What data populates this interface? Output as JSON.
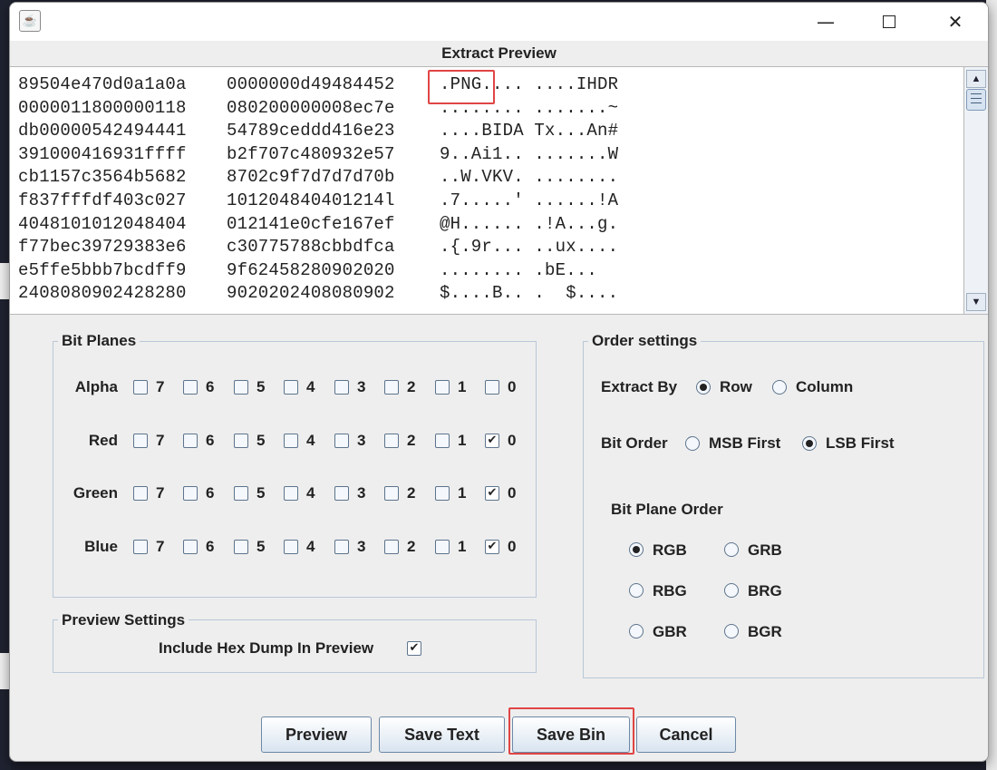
{
  "dialog": {
    "title": "Extract Preview",
    "app_icon": "java-coffee-icon"
  },
  "window_controls": {
    "minimize": "—",
    "close": "✕"
  },
  "preview": {
    "lines": [
      {
        "hex1": "89504e470d0a1a0a",
        "hex2": "0000000d49484452",
        "ascii": ".PNG.... ....IHDR"
      },
      {
        "hex1": "0000011800000118",
        "hex2": "080200000008ec7e",
        "ascii": "........ .......~"
      },
      {
        "hex1": "db00000542494441",
        "hex2": "54789ceddd416e23",
        "ascii": "....BIDA Tx...An#"
      },
      {
        "hex1": "391000416931ffff",
        "hex2": "b2f707c480932e57",
        "ascii": "9..Ai1.. .......W"
      },
      {
        "hex1": "cb1157c3564b5682",
        "hex2": "8702c9f7d7d7d70b",
        "ascii": "..W.VKV. ........"
      },
      {
        "hex1": "f837fffdf403c027",
        "hex2": "101204840401214l",
        "ascii": ".7.....' ......!A"
      },
      {
        "hex1": "4048101012048404",
        "hex2": "012141e0cfe167ef",
        "ascii": "@H...... .!A...g."
      },
      {
        "hex1": "f77bec39729383e6",
        "hex2": "c30775788cbbdfca",
        "ascii": ".{.9r... ..ux...."
      },
      {
        "hex1": "e5ffe5bbb7bcdff9",
        "hex2": "9f62458280902020",
        "ascii": "........ .bE..."
      },
      {
        "hex1": "2408080902428280",
        "hex2": "9020202408080902",
        "ascii": "$....B.. .  $...."
      }
    ]
  },
  "bit_planes": {
    "title": "Bit Planes",
    "bits": [
      "7",
      "6",
      "5",
      "4",
      "3",
      "2",
      "1",
      "0"
    ],
    "rows": [
      {
        "label": "Alpha",
        "checked": [
          false,
          false,
          false,
          false,
          false,
          false,
          false,
          false
        ]
      },
      {
        "label": "Red",
        "checked": [
          false,
          false,
          false,
          false,
          false,
          false,
          false,
          true
        ]
      },
      {
        "label": "Green",
        "checked": [
          false,
          false,
          false,
          false,
          false,
          false,
          false,
          true
        ]
      },
      {
        "label": "Blue",
        "checked": [
          false,
          false,
          false,
          false,
          false,
          false,
          false,
          true
        ]
      }
    ],
    "check_glyph": "✔"
  },
  "preview_settings": {
    "title": "Preview Settings",
    "include_hex_label": "Include Hex Dump In Preview",
    "include_hex_checked": true
  },
  "order_settings": {
    "title": "Order settings",
    "extract_by_label": "Extract By",
    "extract_by_options": [
      "Row",
      "Column"
    ],
    "extract_by_selected": "Row",
    "bit_order_label": "Bit Order",
    "bit_order_options": [
      "MSB First",
      "LSB First"
    ],
    "bit_order_selected": "LSB First",
    "plane_order_label": "Bit Plane Order",
    "plane_order_options": [
      "RGB",
      "GRB",
      "RBG",
      "BRG",
      "GBR",
      "BGR"
    ],
    "plane_order_selected": "RGB"
  },
  "buttons": {
    "preview": "Preview",
    "save_text": "Save Text",
    "save_bin": "Save Bin",
    "cancel": "Cancel"
  }
}
